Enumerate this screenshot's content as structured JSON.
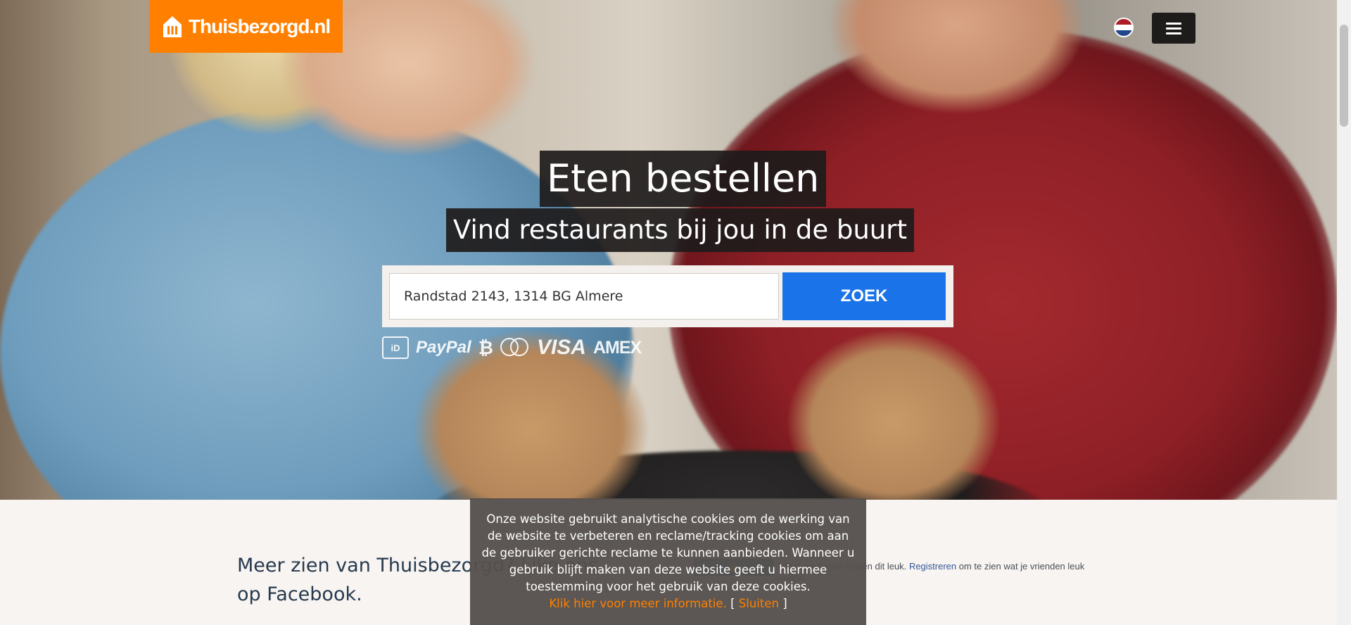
{
  "brand": {
    "logo_text": "Thuisbezorgd.nl",
    "color": "#ff8000"
  },
  "header": {
    "language_flag_icon": "netherlands-flag-icon",
    "menu_icon": "hamburger-menu-icon"
  },
  "hero": {
    "title": "Eten bestellen",
    "subtitle": "Vind restaurants bij jou in de buurt"
  },
  "search": {
    "value": "Randstad 2143, 1314 BG Almere",
    "button_label": "ZOEK",
    "button_color": "#1a73e8"
  },
  "payment_methods": {
    "ideal": "iD",
    "paypal": "PayPal",
    "bitcoin": "₿",
    "visa": "VISA",
    "amex": "AMEX"
  },
  "facebook": {
    "text": "Meer zien van Thuisbezorgd? Like ons op Facebook.",
    "count_text": "288 d. personen vinden dit leuk.",
    "register_link": "Registreren",
    "register_suffix": "om te zien wat je vrienden leuk vinden."
  },
  "cookie_banner": {
    "message": "Onze website gebruikt analytische cookies om de werking van de website te verbeteren en reclame/tracking cookies om aan de gebruiker gerichte reclame te kunnen aanbieden. Wanneer u gebruik blijft maken van deze website geeft u hiermee toestemming voor het gebruik van deze cookies.",
    "more_info_link": "Klik hier voor meer informatie.",
    "bracket_open": "[",
    "close_link": "Sluiten",
    "bracket_close": "]"
  }
}
